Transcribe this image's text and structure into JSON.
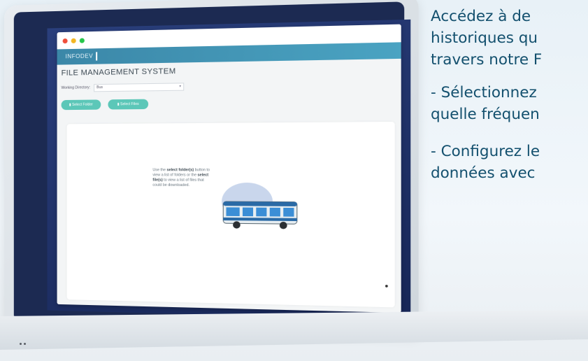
{
  "window": {
    "controls": [
      "close-dot",
      "minimize-dot",
      "maximize-dot"
    ]
  },
  "app": {
    "brand": "INFODEV",
    "page_title": "FILE MANAGEMENT SYSTEM",
    "working_directory": {
      "label": "Working Directory:",
      "value": "Bus"
    },
    "buttons": {
      "select_folders": "Select Folder",
      "select_files": "Select Files"
    },
    "hint": {
      "part1": "Use the ",
      "bold1": "select folder(s)",
      "part2": " button to view a list of folders or the ",
      "bold2": "select file(s)",
      "part3": " to view a list of files that could be downloaded."
    }
  },
  "side_text": {
    "lines": [
      "Accédez à de",
      "historiques qu",
      "travers notre F"
    ],
    "para2": [
      "- Sélectionnez",
      "quelle fréquen"
    ],
    "para3": [
      "- Configurez le",
      "données avec"
    ]
  },
  "colors": {
    "appbar": "#4aa3c2",
    "button": "#5cc7b8",
    "side_text": "#13506e"
  }
}
